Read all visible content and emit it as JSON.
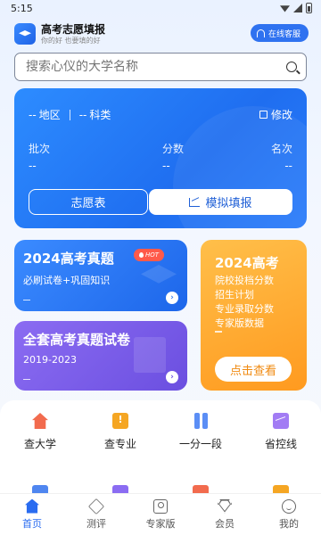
{
  "status_bar": {
    "time": "5:15"
  },
  "header": {
    "app_title": "高考志愿填报",
    "app_subtitle": "你的好 也要填的好",
    "service_label": "在线客服"
  },
  "search": {
    "placeholder": "搜索心仪的大学名称"
  },
  "score_card": {
    "region_value": "--",
    "region_label": "地区",
    "subject_value": "--",
    "subject_label": "科类",
    "edit_label": "修改",
    "stats": [
      {
        "label": "批次",
        "value": "--"
      },
      {
        "label": "分数",
        "value": "--"
      },
      {
        "label": "名次",
        "value": "--"
      }
    ],
    "wish_button": "志愿表",
    "simulate_button": "模拟填报"
  },
  "promos": {
    "exam_2024": {
      "title": "2024高考真题",
      "subtitle": "必刷试卷+巩固知识",
      "badge": "HOT"
    },
    "full_set": {
      "title": "全套高考真题试卷",
      "subtitle": "2019-2023"
    },
    "data_2024": {
      "title": "2024高考",
      "lines": [
        "院校投档分数",
        "招生计划",
        "专业录取分数",
        "专家版数据"
      ],
      "button": "点击查看"
    }
  },
  "services": [
    {
      "label": "查大学",
      "icon": "house-icon"
    },
    {
      "label": "查专业",
      "icon": "book-icon"
    },
    {
      "label": "一分一段",
      "icon": "bars-icon"
    },
    {
      "label": "省控线",
      "icon": "chart-icon"
    }
  ],
  "tabs": [
    {
      "label": "首页",
      "icon": "home-icon",
      "active": true
    },
    {
      "label": "测评",
      "icon": "cube-icon"
    },
    {
      "label": "专家版",
      "icon": "expert-icon"
    },
    {
      "label": "会员",
      "icon": "diamond-icon"
    },
    {
      "label": "我的",
      "icon": "profile-icon"
    }
  ]
}
